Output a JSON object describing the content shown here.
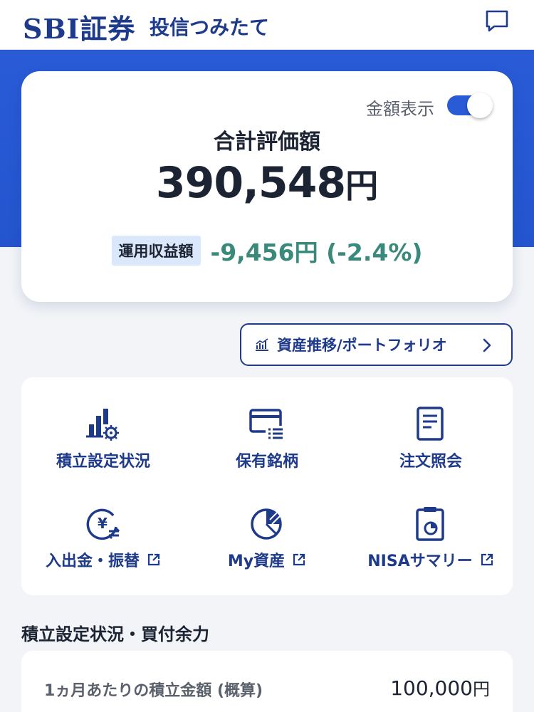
{
  "header": {
    "logo": "SBI証券",
    "app_name": "投信つみたて",
    "chat_icon": "chat-bubble-icon"
  },
  "summary": {
    "amount_display_label": "金額表示",
    "amount_display_on": true,
    "total_label": "合計評価額",
    "total_value": "390,548",
    "total_unit": "円",
    "profit_label": "運用収益額",
    "profit_value": "-9,456円 (-2.4%)"
  },
  "portfolio_button": {
    "label": "資産推移/ポートフォリオ",
    "icon": "chart-icon"
  },
  "menu": [
    {
      "label": "積立設定状況",
      "icon": "bar-chart-gear-icon",
      "external": false
    },
    {
      "label": "保有銘柄",
      "icon": "card-list-icon",
      "external": false
    },
    {
      "label": "注文照会",
      "icon": "document-icon",
      "external": false
    },
    {
      "label": "入出金・振替",
      "icon": "yen-exchange-icon",
      "external": true
    },
    {
      "label": "My資産",
      "icon": "pie-chart-icon",
      "external": true
    },
    {
      "label": "NISAサマリー",
      "icon": "clipboard-chart-icon",
      "external": true
    }
  ],
  "section": {
    "title": "積立設定状況・買付余力",
    "rows": [
      {
        "label": "1ヵ月あたりの積立金額 (概算)",
        "value": "100,000",
        "unit": "円"
      }
    ]
  },
  "colors": {
    "brand": "#1e3a8a",
    "accent": "#2a5bd7",
    "profit": "#3a8a7c",
    "badge": "#dbe8fb"
  }
}
